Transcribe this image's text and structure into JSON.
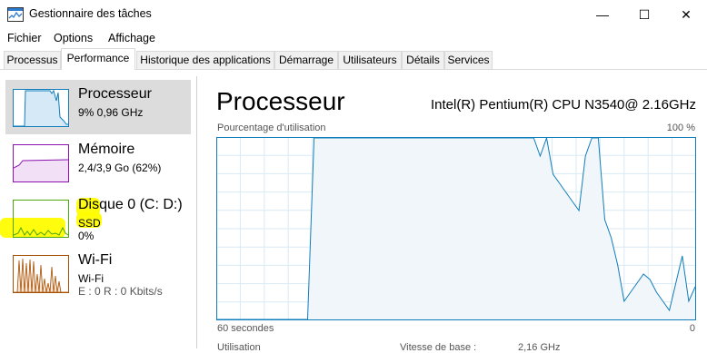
{
  "window": {
    "title": "Gestionnaire des tâches",
    "controls": {
      "minimize": "—",
      "maximize": "☐",
      "close": "✕"
    }
  },
  "menu": [
    "Fichier",
    "Options",
    "Affichage"
  ],
  "tabs": [
    "Processus",
    "Performance",
    "Historique des applications",
    "Démarrage",
    "Utilisateurs",
    "Détails",
    "Services"
  ],
  "active_tab": "Performance",
  "sidebar": [
    {
      "name": "Processeur",
      "line1": "9% 0,96 GHz",
      "line2": ""
    },
    {
      "name": "Mémoire",
      "line1": "2,4/3,9 Go (62%)",
      "line2": ""
    },
    {
      "name": "Disque 0 (C: D:)",
      "line1": "SSD",
      "line2": "0%"
    },
    {
      "name": "Wi-Fi",
      "line1": "Wi-Fi",
      "line2": "E : 0  R : 0 Kbits/s"
    }
  ],
  "colors": {
    "cpu": "#117dbb",
    "memory": "#8b12ae",
    "disk": "#4da60c",
    "wifi": "#a74f01",
    "highlight": "#fffd00"
  },
  "main": {
    "title": "Processeur",
    "cpu_model": "Intel(R) Pentium(R) CPU N3540@ 2.16GHz",
    "graph_label": "Pourcentage d'utilisation",
    "graph_max": "100 %",
    "graph_time_left": "60 secondes",
    "graph_time_right": "0",
    "bottom_partial": [
      "Utilisation",
      "Vitesse de base :",
      "2,16 GHz"
    ]
  },
  "chart_data": {
    "type": "area",
    "x_range": [
      60,
      0
    ],
    "ylim": [
      0,
      100
    ],
    "series": [
      {
        "values": [
          0,
          0,
          0,
          0,
          0,
          0,
          0,
          0,
          0,
          0,
          0,
          0,
          0,
          0,
          0,
          100,
          100,
          100,
          100,
          100,
          100,
          100,
          100,
          100,
          100,
          100,
          100,
          100,
          100,
          100,
          100,
          100,
          100,
          100,
          100,
          100,
          100,
          100,
          100,
          100,
          100,
          100,
          100,
          100,
          100,
          100,
          100,
          100,
          100,
          100,
          90,
          100,
          80,
          75,
          70,
          65,
          60,
          90,
          100,
          100,
          55,
          45,
          30,
          10,
          15,
          20,
          25,
          22,
          15,
          10,
          5,
          20,
          35,
          10,
          18
        ]
      }
    ]
  }
}
